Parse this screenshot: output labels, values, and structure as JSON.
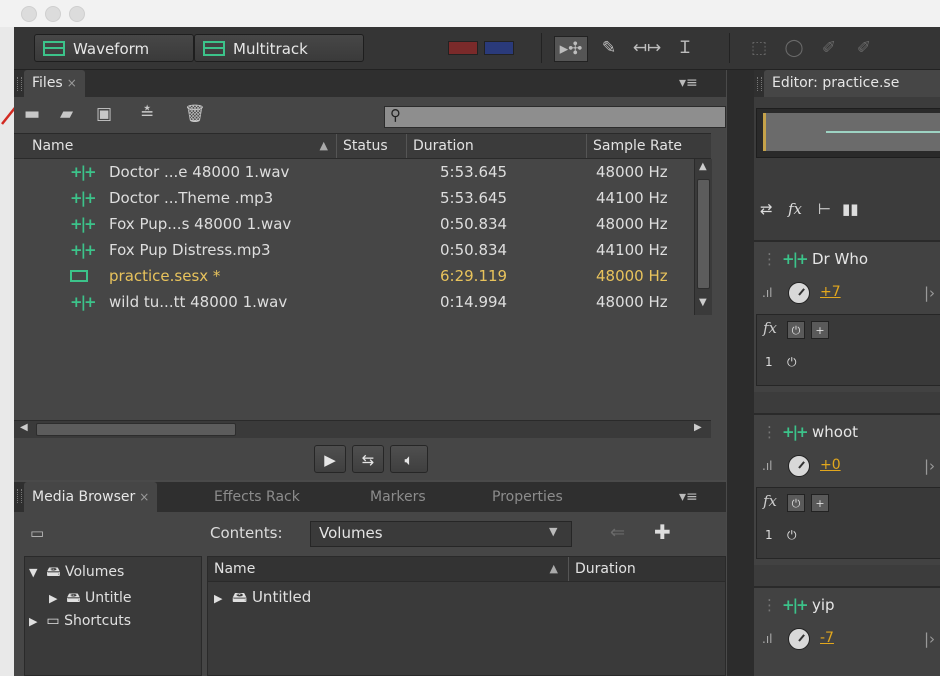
{
  "toolbar": {
    "waveform_label": "Waveform",
    "multitrack_label": "Multitrack"
  },
  "files_panel": {
    "tab_label": "Files",
    "search_placeholder": "",
    "columns": [
      "Name",
      "Status",
      "Duration",
      "Sample Rate"
    ],
    "rows": [
      {
        "name": "Doctor ...e  48000 1.wav",
        "duration": "5:53.645",
        "rate": "48000 Hz",
        "type": "waveform-icon"
      },
      {
        "name": "Doctor ...Theme .mp3",
        "duration": "5:53.645",
        "rate": "44100 Hz",
        "type": "waveform-icon"
      },
      {
        "name": "Fox Pup...s 48000 1.wav",
        "duration": "0:50.834",
        "rate": "48000 Hz",
        "type": "waveform-icon"
      },
      {
        "name": "Fox Pup Distress.mp3",
        "duration": "0:50.834",
        "rate": "44100 Hz",
        "type": "waveform-icon"
      },
      {
        "name": "practice.sesx *",
        "duration": "6:29.119",
        "rate": "48000 Hz",
        "type": "multitrack-icon",
        "selected": true
      },
      {
        "name": "wild tu...tt 48000 1.wav",
        "duration": "0:14.994",
        "rate": "48000 Hz",
        "type": "waveform-icon"
      }
    ]
  },
  "media_panel": {
    "tabs": [
      "Media Browser",
      "Effects Rack",
      "Markers",
      "Properties"
    ],
    "contents_label": "Contents:",
    "contents_value": "Volumes",
    "tree": [
      {
        "label": "Volumes",
        "level": 0
      },
      {
        "label": "Untitle",
        "level": 1
      },
      {
        "label": "Shortcuts",
        "level": 0
      }
    ],
    "columns": [
      "Name",
      "Duration"
    ],
    "rows": [
      {
        "name": "Untitled"
      }
    ]
  },
  "editor_panel": {
    "tab_label": "Editor: practice.se",
    "tracks": [
      {
        "name": "Dr Who",
        "volume": "+7"
      },
      {
        "name": "whoot",
        "volume": "+0"
      },
      {
        "name": "yip",
        "volume": "-7"
      }
    ],
    "track_number": "1"
  },
  "colors": {
    "accent_green": "#3cc38a",
    "selected_file": "#e8c35c",
    "volume_orange": "#e2a71d",
    "annotation_arrow": "#d22a22"
  }
}
